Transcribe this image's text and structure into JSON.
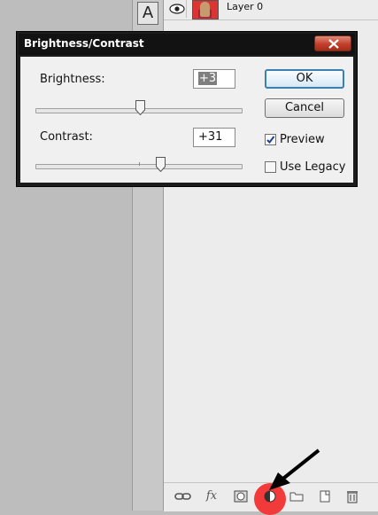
{
  "dialog": {
    "title": "Brightness/Contrast",
    "brightness": {
      "label": "Brightness:",
      "value": "+3",
      "slider_fraction": 0.51
    },
    "contrast": {
      "label": "Contrast:",
      "value": "+31",
      "slider_fraction": 0.61
    },
    "buttons": {
      "ok": "OK",
      "cancel": "Cancel"
    },
    "preview": {
      "label": "Preview",
      "checked": true
    },
    "use_legacy": {
      "label": "Use Legacy",
      "checked": false
    }
  },
  "layers": {
    "rows": [
      {
        "name": "Layer 0"
      }
    ]
  },
  "toolbox": {
    "active_tool": "A"
  },
  "colors": {
    "highlight": "#f23a3a",
    "dialog_frame": "#1c1c1c",
    "close_button": "#c2402c"
  },
  "icons": [
    "eye-icon",
    "link-icon",
    "fx-icon",
    "layer-mask-icon",
    "adjustment-layer-icon",
    "folder-icon",
    "new-layer-icon",
    "trash-icon",
    "close-icon"
  ]
}
